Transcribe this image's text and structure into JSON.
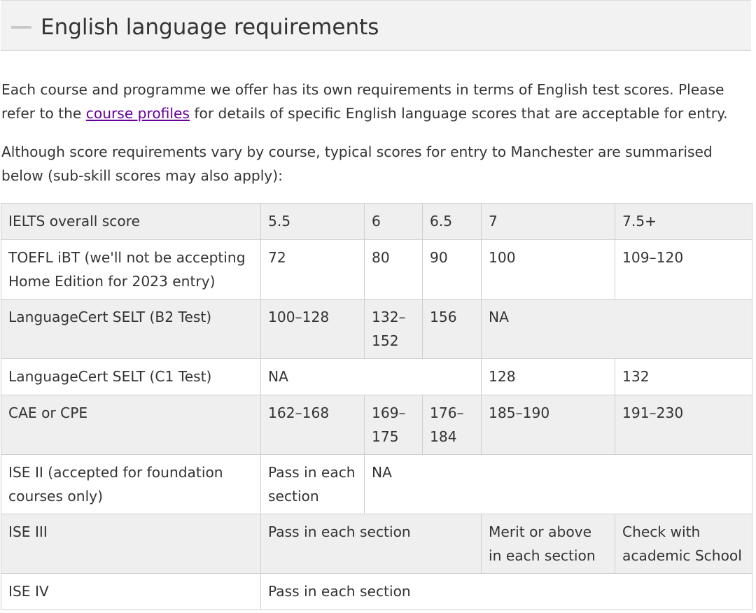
{
  "section": {
    "title": "English language requirements",
    "toggle_icon": "minus-icon"
  },
  "intro": {
    "line1": "Each course and programme we offer has its own requirements in terms of English test scores. Please",
    "line2_before": "refer to the ",
    "link_text": "course profiles",
    "line2_after": " for details of specific English language scores that are acceptable for entry."
  },
  "summary": {
    "line1": "Although score requirements vary by course, typical scores for entry to Manchester are summarised",
    "line2": "below (sub-skill scores may also apply):"
  },
  "table": {
    "rows": [
      {
        "label": "IELTS overall score",
        "c1": "5.5",
        "c2": "6",
        "c3": "6.5",
        "c4": "7",
        "c5": "7.5+"
      },
      {
        "label_l1": "TOEFL iBT (we'll not be accepting",
        "label_l2": "Home Edition for 2023 entry)",
        "c1": "72",
        "c2": "80",
        "c3": "90",
        "c4": "100",
        "c5": "109–120"
      },
      {
        "label": "LanguageCert SELT (B2 Test)",
        "c1": "100–128",
        "c2_l1": "132–",
        "c2_l2": "152",
        "c3": "156",
        "c4": "NA"
      },
      {
        "label": "LanguageCert SELT (C1 Test)",
        "c1": "NA",
        "c4": "128",
        "c5": "132"
      },
      {
        "label": "CAE or CPE",
        "c1": "162–168",
        "c2_l1": "169–",
        "c2_l2": "175",
        "c3_l1": "176–",
        "c3_l2": "184",
        "c4": "185–190",
        "c5": "191–230"
      },
      {
        "label_l1": "ISE II (accepted for foundation",
        "label_l2": "courses only)",
        "c1_l1": "Pass in each",
        "c1_l2": "section",
        "c2": "NA"
      },
      {
        "label": "ISE III",
        "c1": "Pass in each section",
        "c4_l1": "Merit or above",
        "c4_l2": "in each section",
        "c5_l1": "Check with",
        "c5_l2": "academic School"
      },
      {
        "label": "ISE IV",
        "c1": "Pass in each section"
      }
    ]
  }
}
